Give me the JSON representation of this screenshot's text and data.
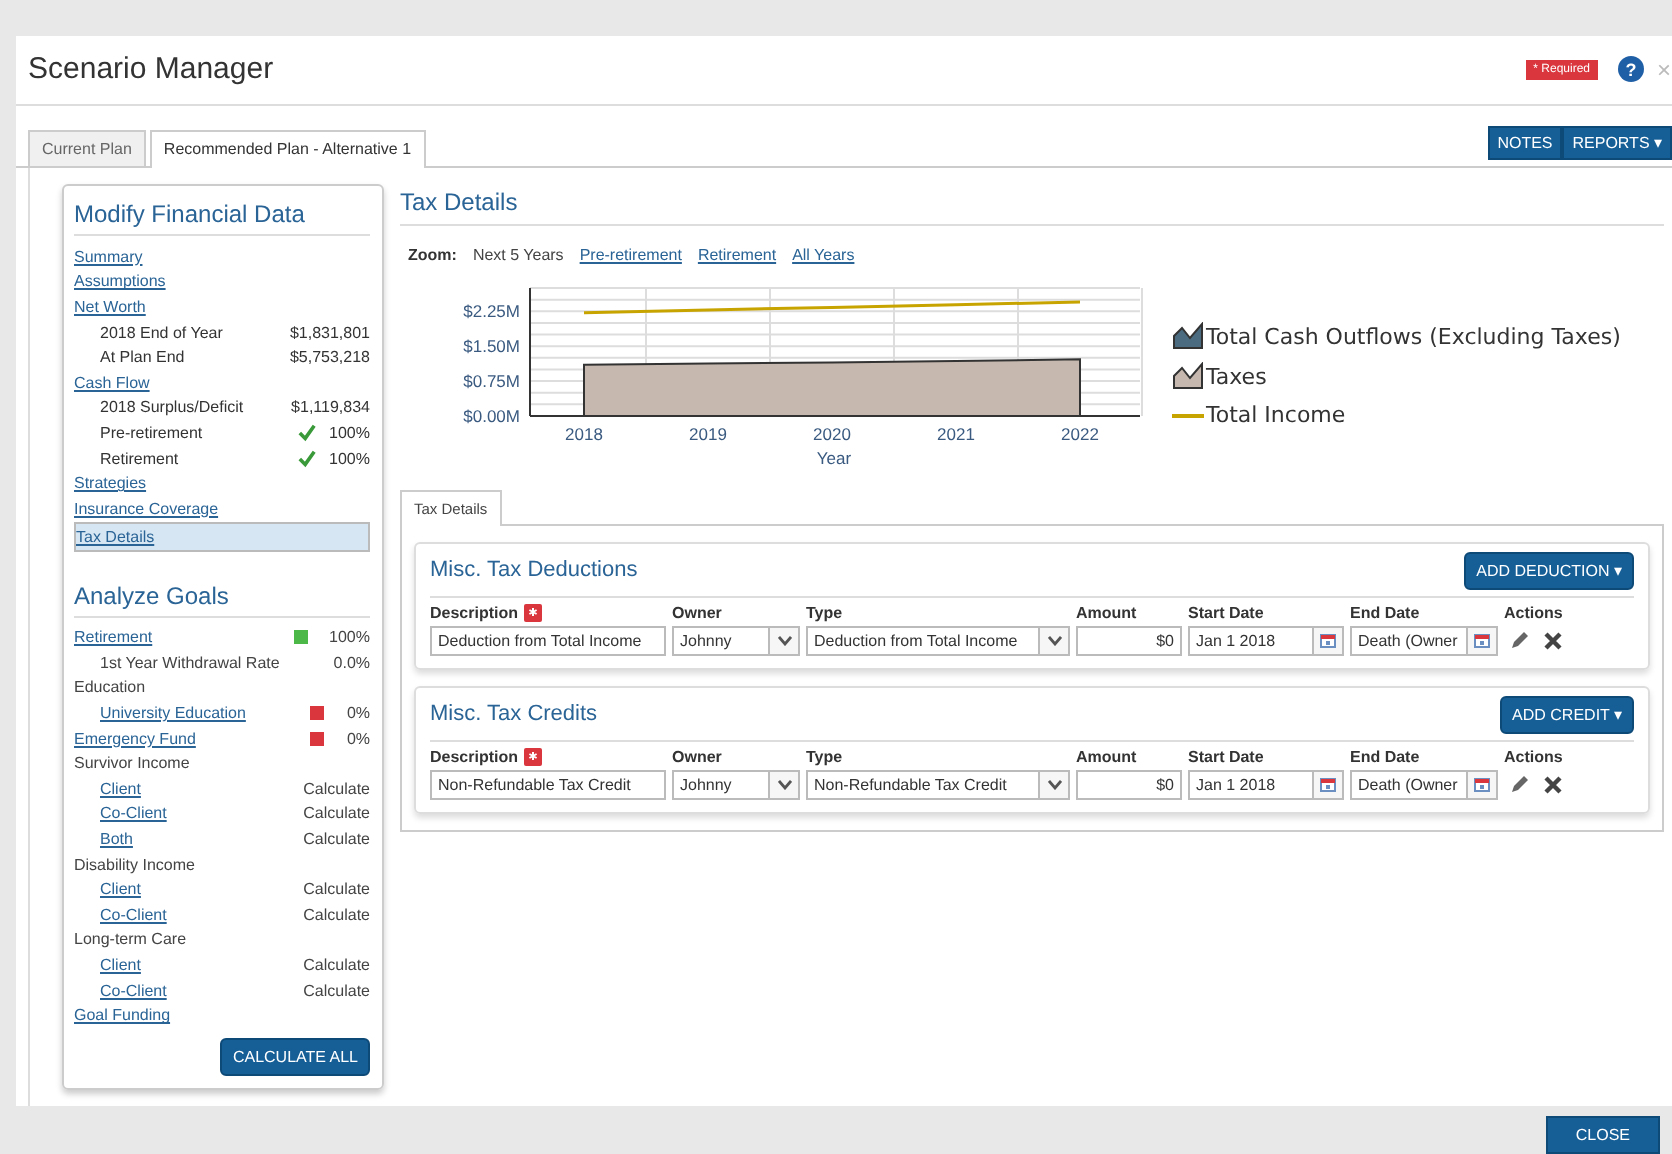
{
  "window": {
    "title": "Scenario Manager",
    "required_badge": "* Required",
    "help": "?",
    "close": "×"
  },
  "tabs": [
    {
      "label": "Current Plan",
      "selected": false
    },
    {
      "label": "Recommended Plan - Alternative 1",
      "selected": true
    }
  ],
  "toolbar": [
    "NOTES",
    "REPORTS ▾"
  ],
  "sidebar": {
    "modify": {
      "title": "Modify Financial Data",
      "items": [
        {
          "label": "Summary",
          "kind": "link",
          "selected": false
        },
        {
          "label": "Assumptions",
          "kind": "link",
          "selected": false
        },
        {
          "label": "Net Worth",
          "kind": "link",
          "selected": false,
          "children": [
            {
              "label": "2018 End of Year",
              "value": "$1,831,801"
            },
            {
              "label": "At Plan End",
              "value": "$5,753,218"
            }
          ]
        },
        {
          "label": "Cash Flow",
          "kind": "link",
          "selected": false,
          "children": [
            {
              "label": "2018 Surplus/Deficit",
              "value": "$1,119,834"
            },
            {
              "label": "Pre-retirement",
              "value": "100%",
              "check": true
            },
            {
              "label": "Retirement",
              "value": "100%",
              "check": true
            }
          ]
        },
        {
          "label": "Strategies",
          "kind": "link",
          "selected": false
        },
        {
          "label": "Insurance Coverage",
          "kind": "link",
          "selected": false
        },
        {
          "label": "Tax Details",
          "kind": "link",
          "selected": true
        }
      ]
    },
    "analyze": {
      "title": "Analyze Goals",
      "items": [
        {
          "label": "Retirement",
          "kind": "link",
          "value": "100%",
          "color": "#4cb848",
          "children": [
            {
              "label": "1st Year Withdrawal Rate",
              "kind": "text",
              "value": "0.0%"
            }
          ]
        },
        {
          "label": "Education",
          "kind": "text",
          "children": [
            {
              "label": "University Education",
              "kind": "link",
              "value": "0%",
              "color": "#d9363e"
            }
          ]
        },
        {
          "label": "Emergency Fund",
          "kind": "link",
          "value": "0%",
          "color": "#d9363e"
        },
        {
          "label": "Survivor Income",
          "kind": "text",
          "children": [
            {
              "label": "Client",
              "kind": "link",
              "value": "Calculate"
            },
            {
              "label": "Co-Client",
              "kind": "link",
              "value": "Calculate"
            },
            {
              "label": "Both",
              "kind": "link",
              "value": "Calculate"
            }
          ]
        },
        {
          "label": "Disability Income",
          "kind": "text",
          "children": [
            {
              "label": "Client",
              "kind": "link",
              "value": "Calculate"
            },
            {
              "label": "Co-Client",
              "kind": "link",
              "value": "Calculate"
            }
          ]
        },
        {
          "label": "Long-term Care",
          "kind": "text",
          "children": [
            {
              "label": "Client",
              "kind": "link",
              "value": "Calculate"
            },
            {
              "label": "Co-Client",
              "kind": "link",
              "value": "Calculate"
            }
          ]
        },
        {
          "label": "Goal Funding",
          "kind": "link"
        }
      ],
      "button": "CALCULATE ALL"
    }
  },
  "main": {
    "title": "Tax Details",
    "zoom_label": "Zoom:",
    "zoom_options": [
      {
        "label": "Next 5 Years",
        "selected": true
      },
      {
        "label": "Pre-retirement",
        "selected": false
      },
      {
        "label": "Retirement",
        "selected": false
      },
      {
        "label": "All Years",
        "selected": false
      }
    ],
    "chart_data": {
      "type": "area",
      "grid": true,
      "xlabel": "Year",
      "categories": [
        "2018",
        "2019",
        "2020",
        "2021",
        "2022"
      ],
      "ylim": [
        0,
        2.75
      ],
      "yticks": [
        {
          "value": 0,
          "label": "$0.00M"
        },
        {
          "value": 0.75,
          "label": "$0.75M"
        },
        {
          "value": 1.5,
          "label": "$1.50M"
        },
        {
          "value": 2.25,
          "label": "$2.25M"
        }
      ],
      "series": [
        {
          "name": "Total Cash Outflows (Excluding Taxes)",
          "color": "#4a6b80",
          "values": [
            null,
            null,
            null,
            null,
            null
          ]
        },
        {
          "name": "Taxes",
          "color": "#c6b8ae",
          "values": [
            1.1,
            1.13,
            1.15,
            1.18,
            1.22
          ]
        },
        {
          "name": "Total Income",
          "type": "line",
          "color": "#c8a400",
          "values": [
            2.22,
            2.28,
            2.33,
            2.39,
            2.45
          ]
        }
      ]
    },
    "sub_tab": {
      "label": "Tax Details",
      "selected": true
    },
    "sections": [
      {
        "title": "Misc. Tax Deductions",
        "button": "ADD DEDUCTION ▾",
        "columns": [
          "Description",
          "Owner",
          "Type",
          "Amount",
          "Start Date",
          "End Date",
          "Actions"
        ],
        "rows": [
          {
            "description": "Deduction from Total Income",
            "owner": "Johnny",
            "type": "Deduction from Total Income",
            "amount": "$0",
            "start_date": "Jan 1 2018",
            "end_date": "Death (Owner"
          }
        ]
      },
      {
        "title": "Misc. Tax Credits",
        "button": "ADD CREDIT ▾",
        "columns": [
          "Description",
          "Owner",
          "Type",
          "Amount",
          "Start Date",
          "End Date",
          "Actions"
        ],
        "rows": [
          {
            "description": "Non-Refundable Tax Credit",
            "owner": "Johnny",
            "type": "Non-Refundable Tax Credit",
            "amount": "$0",
            "start_date": "Jan 1 2018",
            "end_date": "Death (Owner"
          }
        ]
      }
    ]
  },
  "footer": {
    "button": "CLOSE"
  }
}
